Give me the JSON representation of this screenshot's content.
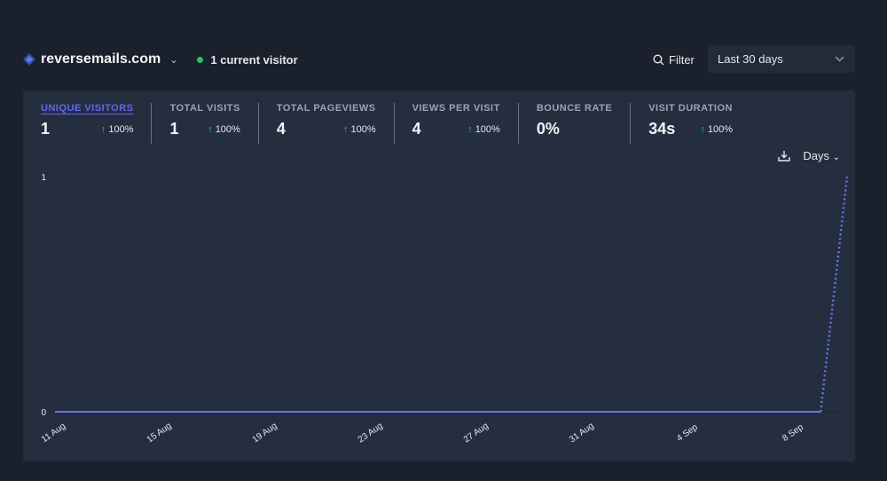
{
  "header": {
    "site": "reversemails.com",
    "current_visitors": "1 current visitor",
    "filter_label": "Filter",
    "period": "Last 30 days"
  },
  "metrics": [
    {
      "label": "UNIQUE VISITORS",
      "value": "1",
      "change": "100%",
      "active": true
    },
    {
      "label": "TOTAL VISITS",
      "value": "1",
      "change": "100%"
    },
    {
      "label": "TOTAL PAGEVIEWS",
      "value": "4",
      "change": "100%"
    },
    {
      "label": "VIEWS PER VISIT",
      "value": "4",
      "change": "100%"
    },
    {
      "label": "BOUNCE RATE",
      "value": "0%",
      "change": null
    },
    {
      "label": "VISIT DURATION",
      "value": "34s",
      "change": "100%"
    }
  ],
  "interval": "Days",
  "colors": {
    "accent": "#6366f1",
    "line": "#6574e6",
    "up": "#22c55e"
  },
  "chart_data": {
    "type": "line",
    "x": [
      "11 Aug",
      "12 Aug",
      "13 Aug",
      "14 Aug",
      "15 Aug",
      "16 Aug",
      "17 Aug",
      "18 Aug",
      "19 Aug",
      "20 Aug",
      "21 Aug",
      "22 Aug",
      "23 Aug",
      "24 Aug",
      "25 Aug",
      "26 Aug",
      "27 Aug",
      "28 Aug",
      "29 Aug",
      "30 Aug",
      "31 Aug",
      "1 Sep",
      "2 Sep",
      "3 Sep",
      "4 Sep",
      "5 Sep",
      "6 Sep",
      "7 Sep",
      "8 Sep",
      "9 Sep",
      "10 Sep"
    ],
    "series": [
      {
        "name": "Unique visitors",
        "values": [
          0,
          0,
          0,
          0,
          0,
          0,
          0,
          0,
          0,
          0,
          0,
          0,
          0,
          0,
          0,
          0,
          0,
          0,
          0,
          0,
          0,
          0,
          0,
          0,
          0,
          0,
          0,
          0,
          0,
          0,
          1
        ]
      }
    ],
    "xticks": [
      "11 Aug",
      "15 Aug",
      "19 Aug",
      "23 Aug",
      "27 Aug",
      "31 Aug",
      "4 Sep",
      "8 Sep"
    ],
    "yticks": [
      "0",
      "1"
    ],
    "ylim": [
      0,
      1
    ],
    "dotted_last_segment": true
  }
}
